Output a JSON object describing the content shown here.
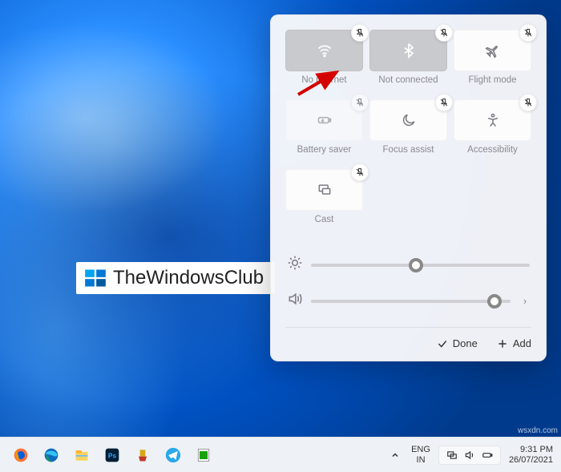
{
  "watermark": {
    "text": "TheWindowsClub"
  },
  "panel": {
    "tiles": [
      {
        "label": "No internet",
        "icon": "wifi",
        "state": "active"
      },
      {
        "label": "Not connected",
        "icon": "bluetooth",
        "state": "active"
      },
      {
        "label": "Flight mode",
        "icon": "airplane",
        "state": "normal"
      },
      {
        "label": "Battery saver",
        "icon": "battery",
        "state": "faint"
      },
      {
        "label": "Focus assist",
        "icon": "moon",
        "state": "normal"
      },
      {
        "label": "Accessibility",
        "icon": "accessibility",
        "state": "normal"
      },
      {
        "label": "Cast",
        "icon": "cast",
        "state": "normal"
      }
    ],
    "brightness_percent": 48,
    "volume_percent": 92,
    "footer": {
      "done": "Done",
      "add": "Add"
    }
  },
  "taskbar": {
    "apps": [
      {
        "name": "firefox"
      },
      {
        "name": "edge"
      },
      {
        "name": "file-explorer"
      },
      {
        "name": "photoshop"
      },
      {
        "name": "ccleaner"
      },
      {
        "name": "telegram"
      },
      {
        "name": "libreoffice-calc"
      }
    ],
    "chevron": "^",
    "language": {
      "top": "ENG",
      "bottom": "IN"
    },
    "tray": {
      "icons": [
        "project",
        "volume",
        "battery"
      ]
    },
    "clock": {
      "time": "9:31 PM",
      "date": "26/07/2021"
    }
  },
  "corner_text": "wsxdn.com"
}
